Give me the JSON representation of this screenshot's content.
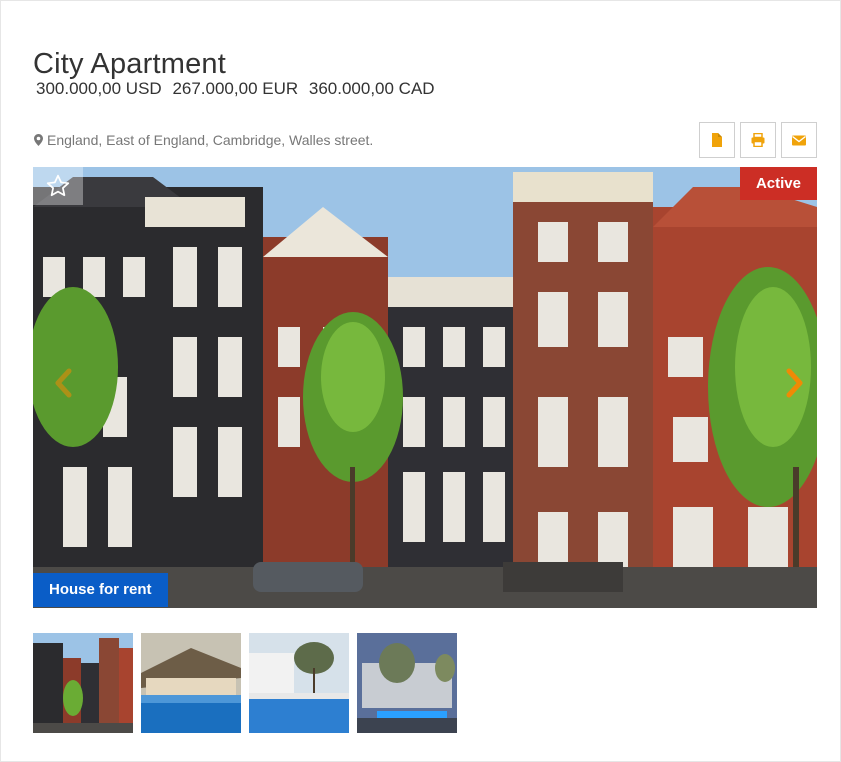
{
  "listing": {
    "title": "City Apartment",
    "prices": [
      "300.000,00 USD",
      "267.000,00 EUR",
      "360.000,00 CAD"
    ],
    "address": "England, East of England, Cambridge, Walles street."
  },
  "toolbar": {
    "icons": [
      "file-icon",
      "print-icon",
      "envelope-icon"
    ],
    "accent": "#f0a30a"
  },
  "gallery": {
    "status_label": "Active",
    "status_color": "#cc2e25",
    "type_label": "House for rent",
    "type_color": "#0a5dc7",
    "thumbnail_count": 4
  }
}
